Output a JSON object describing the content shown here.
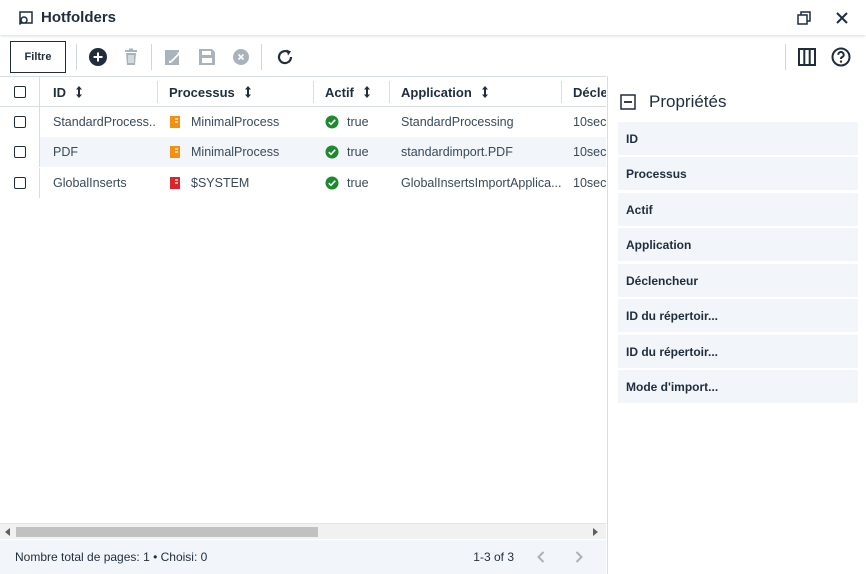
{
  "window": {
    "title": "Hotfolders",
    "restore_icon": "restore-window-icon",
    "close_icon": "close-icon"
  },
  "toolbar": {
    "filter_label": "Filtre",
    "icons": [
      "add-icon",
      "delete-icon",
      "edit-icon",
      "save-icon",
      "cancel-icon",
      "refresh-icon"
    ],
    "right_icons": [
      "columns-icon",
      "help-icon"
    ]
  },
  "table": {
    "columns": [
      "ID",
      "Processus",
      "Actif",
      "Application",
      "Décle"
    ],
    "rows": [
      {
        "id": "StandardProcess...",
        "process": "MinimalProcess",
        "process_color": "#f29111",
        "active": "true",
        "application": "StandardProcessing",
        "trigger": "10sec"
      },
      {
        "id": "PDF",
        "process": "MinimalProcess",
        "process_color": "#f29111",
        "active": "true",
        "application": "standardimport.PDF",
        "trigger": "10sec"
      },
      {
        "id": "GlobalInserts",
        "process": "$SYSTEM",
        "process_color": "#d9252b",
        "active": "true",
        "application": "GlobalInsertsImportApplica...",
        "trigger": "10sec"
      }
    ]
  },
  "footer": {
    "summary": "Nombre total de pages: 1 • Choisi: 0",
    "range": "1-3 of 3"
  },
  "properties": {
    "title": "Propriétés",
    "items": [
      "ID",
      "Processus",
      "Actif",
      "Application",
      "Déclencheur",
      "ID du répertoir...",
      "ID du répertoir...",
      "Mode d'import..."
    ]
  },
  "colors": {
    "accent": "#1f2d3d",
    "active_green": "#1e8a2e",
    "row_alt": "#f2f5f9"
  }
}
